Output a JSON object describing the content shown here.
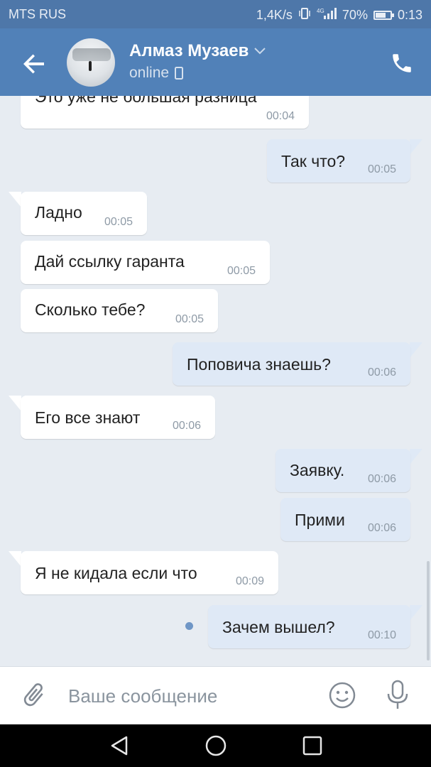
{
  "status_bar": {
    "carrier": "MTS RUS",
    "speed": "1,4K/s",
    "network": "4G",
    "battery": "70%",
    "battery_level": 0.7,
    "time": "0:13"
  },
  "header": {
    "contact_name": "Алмаз Музаев",
    "status": "online"
  },
  "messages": [
    {
      "dir": "in",
      "text": "Это уже не большая разница",
      "time": "00:04"
    },
    {
      "dir": "out",
      "text": "Так что?",
      "time": "00:05"
    },
    {
      "dir": "in",
      "text": "Ладно",
      "time": "00:05"
    },
    {
      "dir": "in",
      "text": "Дай ссылку гаранта",
      "time": "00:05"
    },
    {
      "dir": "in",
      "text": "Сколько тебе?",
      "time": "00:05"
    },
    {
      "dir": "out",
      "text": "Поповича знаешь?",
      "time": "00:06"
    },
    {
      "dir": "in",
      "text": "Его все знают",
      "time": "00:06"
    },
    {
      "dir": "out",
      "text": "Заявку.",
      "time": "00:06"
    },
    {
      "dir": "out",
      "text": "Прими",
      "time": "00:06"
    },
    {
      "dir": "in",
      "text": "Я не кидала если что",
      "time": "00:09"
    },
    {
      "dir": "out",
      "text": "Зачем вышел?",
      "time": "00:10"
    }
  ],
  "composer": {
    "placeholder": "Ваше сообщение"
  },
  "colors": {
    "header": "#5181b8",
    "status_bar": "#4e77a9",
    "background": "#e7ecf2",
    "outgoing": "#dfe9f6",
    "incoming": "#ffffff"
  },
  "icons": [
    "back-arrow-icon",
    "chevron-down-icon",
    "phone-icon",
    "device-icon",
    "attach-icon",
    "emoji-icon",
    "mic-icon",
    "nav-back-icon",
    "nav-home-icon",
    "nav-recents-icon"
  ]
}
